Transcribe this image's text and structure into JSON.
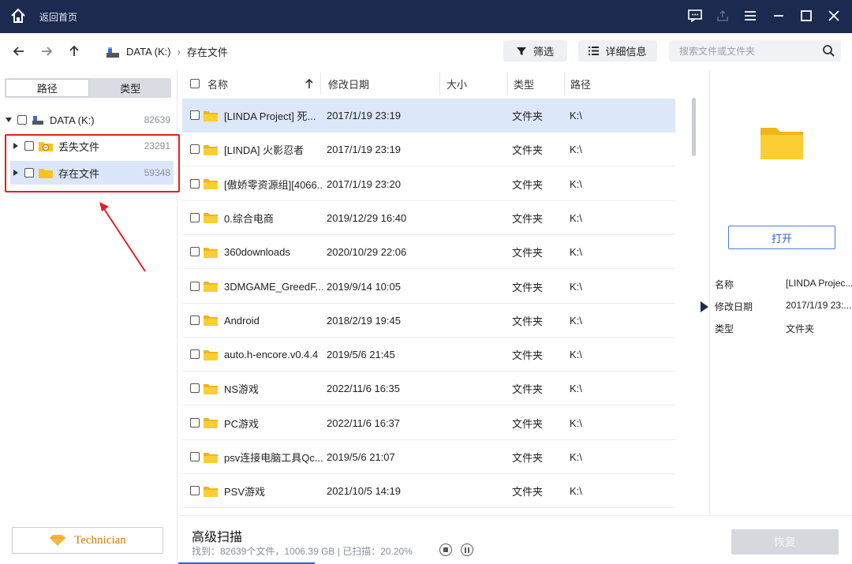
{
  "titlebar": {
    "back_home": "返回首页"
  },
  "breadcrumb": {
    "drive": "DATA (K:)",
    "folder": "存在文件"
  },
  "toolbar": {
    "filter_label": "筛选",
    "details_label": "详细信息"
  },
  "search": {
    "placeholder": "搜索文件或文件夹"
  },
  "left": {
    "tabs": [
      "路径",
      "类型"
    ],
    "root": {
      "label": "DATA (K:)",
      "count": "82639"
    },
    "items": [
      {
        "label": "丢失文件",
        "count": "23291"
      },
      {
        "label": "存在文件",
        "count": "59348"
      }
    ],
    "technician": "Technician"
  },
  "columns": {
    "name": "名称",
    "date": "修改日期",
    "size": "大小",
    "type": "类型",
    "path": "路径"
  },
  "rows": [
    {
      "name": "[LINDA Project] 死...",
      "date": "2017/1/19 23:19",
      "size": "",
      "type": "文件夹",
      "path": "K:\\"
    },
    {
      "name": "[LINDA] 火影忍者",
      "date": "2017/1/19 23:19",
      "size": "",
      "type": "文件夹",
      "path": "K:\\"
    },
    {
      "name": "[傲娇零资源组][4066...",
      "date": "2017/1/19 23:20",
      "size": "",
      "type": "文件夹",
      "path": "K:\\"
    },
    {
      "name": "0.综合电商",
      "date": "2019/12/29 16:40",
      "size": "",
      "type": "文件夹",
      "path": "K:\\"
    },
    {
      "name": "360downloads",
      "date": "2020/10/29 22:06",
      "size": "",
      "type": "文件夹",
      "path": "K:\\"
    },
    {
      "name": "3DMGAME_GreedF...",
      "date": "2019/9/14 10:05",
      "size": "",
      "type": "文件夹",
      "path": "K:\\"
    },
    {
      "name": "Android",
      "date": "2018/2/19 19:45",
      "size": "",
      "type": "文件夹",
      "path": "K:\\"
    },
    {
      "name": "auto.h-encore.v0.4.4",
      "date": "2019/5/6 21:45",
      "size": "",
      "type": "文件夹",
      "path": "K:\\"
    },
    {
      "name": "NS游戏",
      "date": "2022/11/6 16:35",
      "size": "",
      "type": "文件夹",
      "path": "K:\\"
    },
    {
      "name": "PC游戏",
      "date": "2022/11/6 16:37",
      "size": "",
      "type": "文件夹",
      "path": "K:\\"
    },
    {
      "name": "psv连接电脑工具Qc...",
      "date": "2019/5/6 21:07",
      "size": "",
      "type": "文件夹",
      "path": "K:\\"
    },
    {
      "name": "PSV游戏",
      "date": "2021/10/5 14:19",
      "size": "",
      "type": "文件夹",
      "path": "K:\\"
    }
  ],
  "detail": {
    "open_label": "打开",
    "props": [
      {
        "key": "名称",
        "value": "[LINDA Projec..."
      },
      {
        "key": "修改日期",
        "value": "2017/1/19 23:..."
      },
      {
        "key": "类型",
        "value": "文件夹"
      }
    ]
  },
  "status": {
    "title": "高级扫描",
    "info": "找到：82639个文件，1006.39 GB | 已扫描：20.20%",
    "scan_progress": 0.202,
    "recover_label": "恢复"
  },
  "colors": {
    "titlebar": "#1c2a4f",
    "accent": "#2f62c6",
    "folder": "#f7c31f",
    "highlight": "#e02020"
  }
}
